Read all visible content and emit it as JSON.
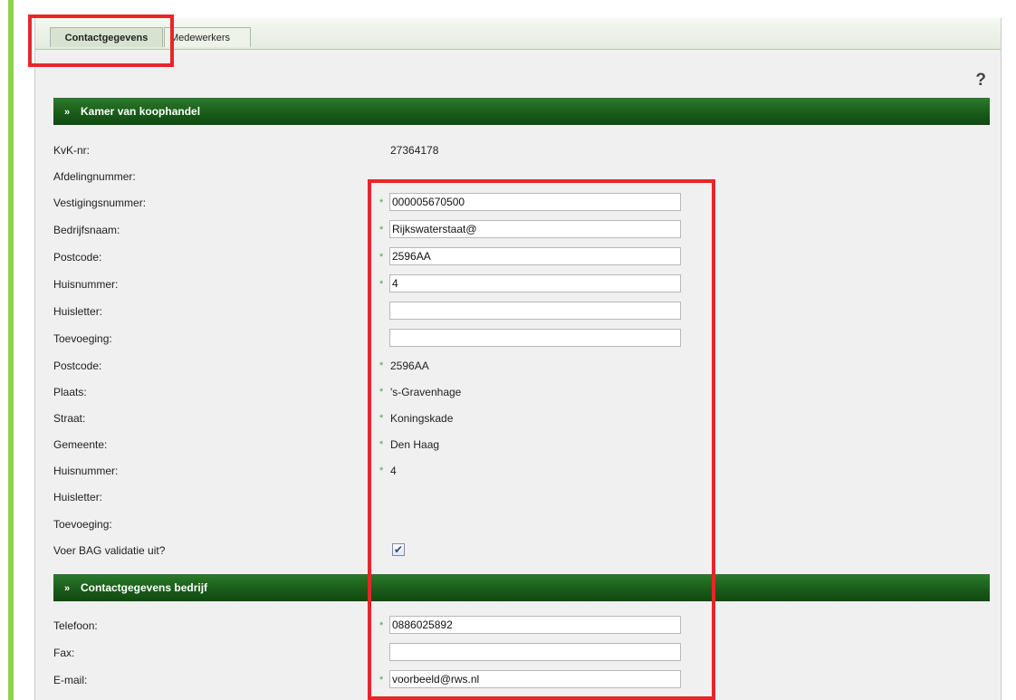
{
  "tabs": [
    {
      "label": "Contactgegevens",
      "active": true
    },
    {
      "label": "Medewerkers",
      "active": false
    }
  ],
  "help_icon_text": "?",
  "section_kvk": {
    "title": "Kamer van koophandel",
    "chevron": "»",
    "kvk_nr": {
      "label": "KvK-nr:",
      "value": "27364178"
    },
    "afdelingnummer": {
      "label": "Afdelingnummer:"
    },
    "vestigingsnummer": {
      "label": "Vestigingsnummer:",
      "value": "000005670500"
    },
    "bedrijfsnaam": {
      "label": "Bedrijfsnaam:",
      "value": "Rijkswaterstaat@"
    },
    "postcode_input": {
      "label": "Postcode:",
      "value": "2596AA"
    },
    "huisnummer_input": {
      "label": "Huisnummer:",
      "value": "4"
    },
    "huisletter_input": {
      "label": "Huisletter:",
      "value": ""
    },
    "toevoeging_input": {
      "label": "Toevoeging:",
      "value": ""
    },
    "postcode": {
      "label": "Postcode:",
      "value": "2596AA"
    },
    "plaats": {
      "label": "Plaats:",
      "value": "'s-Gravenhage"
    },
    "straat": {
      "label": "Straat:",
      "value": "Koningskade"
    },
    "gemeente": {
      "label": "Gemeente:",
      "value": "Den Haag"
    },
    "huisnummer": {
      "label": "Huisnummer:",
      "value": "4"
    },
    "huisletter": {
      "label": "Huisletter:"
    },
    "toevoeging": {
      "label": "Toevoeging:"
    },
    "bag_validatie": {
      "label": "Voer BAG validatie uit?",
      "checked": true,
      "check_glyph": "✔"
    }
  },
  "section_contact": {
    "title": "Contactgegevens bedrijf",
    "chevron": "»",
    "telefoon": {
      "label": "Telefoon:",
      "value": "0886025892"
    },
    "fax": {
      "label": "Fax:",
      "value": ""
    },
    "email": {
      "label": "E-mail:",
      "value": "voorbeeld@rws.nl"
    }
  },
  "required_marker": "*",
  "colors": {
    "header_green": "#1a5c1a",
    "highlight_red": "#e8262a",
    "accent_green": "#8fd24f",
    "required_green": "#48a448"
  }
}
